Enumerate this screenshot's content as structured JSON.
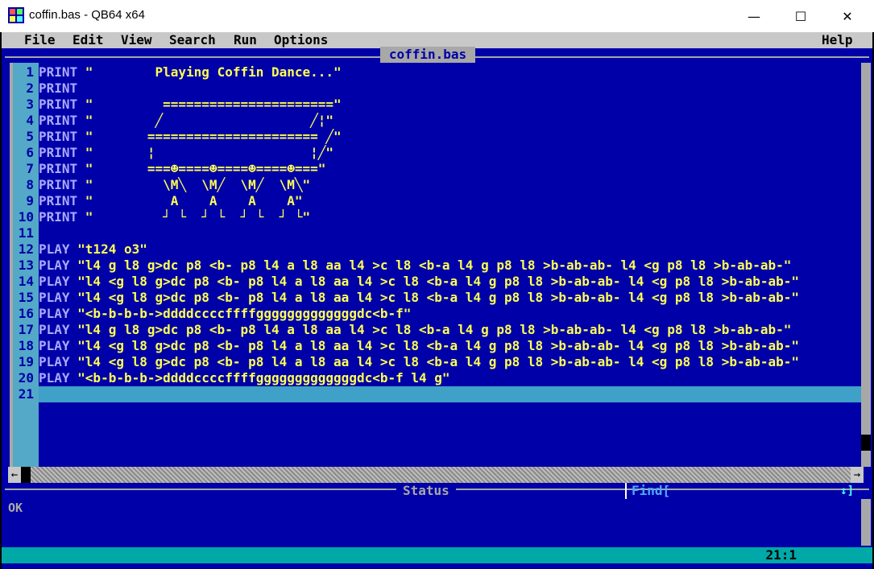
{
  "window": {
    "title": "coffin.bas - QB64 x64",
    "minimize_glyph": "—",
    "maximize_glyph": "☐",
    "close_glyph": "✕"
  },
  "menu": {
    "file": "File",
    "edit": "Edit",
    "view": "View",
    "search": "Search",
    "run": "Run",
    "options": "Options",
    "help": "Help"
  },
  "editor": {
    "filename": "coffin.bas",
    "lines": [
      {
        "n": "1",
        "kw": "PRINT",
        "rest": " \"        Playing Coffin Dance...\""
      },
      {
        "n": "2",
        "kw": "PRINT",
        "rest": ""
      },
      {
        "n": "3",
        "kw": "PRINT",
        "rest": " \"         ======================\""
      },
      {
        "n": "4",
        "kw": "PRINT",
        "rest": " \"        ╱                   ╱¦\""
      },
      {
        "n": "5",
        "kw": "PRINT",
        "rest": " \"       ====================== ╱\""
      },
      {
        "n": "6",
        "kw": "PRINT",
        "rest": " \"       ¦                    ¦╱\""
      },
      {
        "n": "7",
        "kw": "PRINT",
        "rest": " \"       ===☻====☻====☻====☻===\""
      },
      {
        "n": "8",
        "kw": "PRINT",
        "rest": " \"         \\M╲  \\M╱  \\M╱  \\M╲\""
      },
      {
        "n": "9",
        "kw": "PRINT",
        "rest": " \"          A    A    A    A\""
      },
      {
        "n": "10",
        "kw": "PRINT",
        "rest": " \"         ┘ └  ┘ └  ┘ └  ┘ └\""
      },
      {
        "n": "11",
        "kw": "",
        "rest": ""
      },
      {
        "n": "12",
        "kw": "PLAY",
        "rest": " \"t124 o3\""
      },
      {
        "n": "13",
        "kw": "PLAY",
        "rest": " \"l4 g l8 g>dc p8 <b- p8 l4 a l8 aa l4 >c l8 <b-a l4 g p8 l8 >b-ab-ab- l4 <g p8 l8 >b-ab-ab-\""
      },
      {
        "n": "14",
        "kw": "PLAY",
        "rest": " \"l4 <g l8 g>dc p8 <b- p8 l4 a l8 aa l4 >c l8 <b-a l4 g p8 l8 >b-ab-ab- l4 <g p8 l8 >b-ab-ab-\""
      },
      {
        "n": "15",
        "kw": "PLAY",
        "rest": " \"l4 <g l8 g>dc p8 <b- p8 l4 a l8 aa l4 >c l8 <b-a l4 g p8 l8 >b-ab-ab- l4 <g p8 l8 >b-ab-ab-\""
      },
      {
        "n": "16",
        "kw": "PLAY",
        "rest": " \"<b-b-b-b->ddddccccffffgggggggggggggdc<b-f\""
      },
      {
        "n": "17",
        "kw": "PLAY",
        "rest": " \"l4 g l8 g>dc p8 <b- p8 l4 a l8 aa l4 >c l8 <b-a l4 g p8 l8 >b-ab-ab- l4 <g p8 l8 >b-ab-ab-\""
      },
      {
        "n": "18",
        "kw": "PLAY",
        "rest": " \"l4 <g l8 g>dc p8 <b- p8 l4 a l8 aa l4 >c l8 <b-a l4 g p8 l8 >b-ab-ab- l4 <g p8 l8 >b-ab-ab-\""
      },
      {
        "n": "19",
        "kw": "PLAY",
        "rest": " \"l4 <g l8 g>dc p8 <b- p8 l4 a l8 aa l4 >c l8 <b-a l4 g p8 l8 >b-ab-ab- l4 <g p8 l8 >b-ab-ab-\""
      },
      {
        "n": "20",
        "kw": "PLAY",
        "rest": " \"<b-b-b-b->ddddccccffffgggggggggggggdc<b-f l4 g\""
      },
      {
        "n": "21",
        "kw": "",
        "rest": ""
      }
    ]
  },
  "hscroll": {
    "left_arrow": "←",
    "right_arrow": "→"
  },
  "status": {
    "label": "Status",
    "message": "OK",
    "find_label": "Find[",
    "find_arrows": "↕]",
    "cursor_position": "21:1"
  },
  "colors": {
    "background": "#0000a8",
    "keyword": "#aaaaff",
    "string": "#ffff55",
    "cursor_row": "#3fa0c8"
  }
}
